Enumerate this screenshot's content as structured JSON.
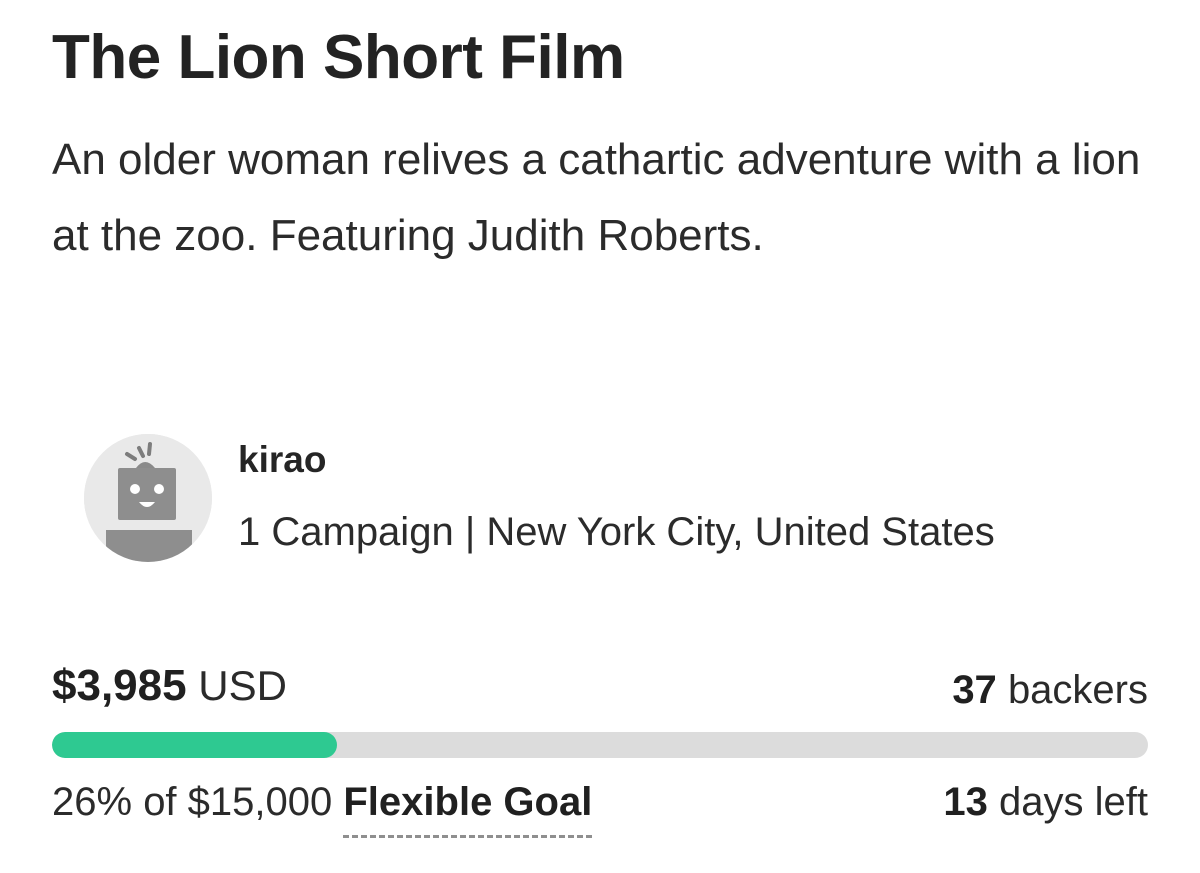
{
  "campaign": {
    "title": "The Lion Short Film",
    "blurb": "An older woman relives a cathartic adventure with a lion at the zoo. Featuring Judith Roberts."
  },
  "owner": {
    "avatar_icon": "robot-avatar-icon",
    "name": "kirao",
    "campaigns": "1 Campaign",
    "separator": "|",
    "location": "New York City, United States"
  },
  "funding": {
    "amount": "$3,985",
    "currency": "USD",
    "backers_count": "37",
    "backers_label": "backers",
    "percent_text": "26%",
    "goal_text": "of $15,000",
    "goal_type": "Flexible Goal",
    "days_count": "13",
    "days_label": "days left",
    "progress_fraction": 0.26,
    "progress_color": "#2ec991",
    "track_color": "#dcdcdc"
  }
}
